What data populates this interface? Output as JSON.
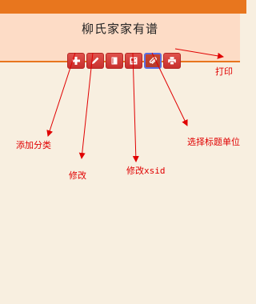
{
  "header": {
    "title": "柳氏家家有谱"
  },
  "toolbar": {
    "buttons": [
      {
        "icon": "plus-icon"
      },
      {
        "icon": "pencil-icon"
      },
      {
        "icon": "book-icon"
      },
      {
        "icon": "id-card-icon"
      },
      {
        "icon": "paperclip-icon",
        "selected": true
      },
      {
        "icon": "printer-icon"
      }
    ]
  },
  "annotations": {
    "add_category": "添加分类",
    "edit": "修改",
    "edit_xsid": "修改xsid",
    "select_title_unit": "选择标题单位",
    "print": "打印"
  },
  "colors": {
    "background": "#f8efe0",
    "top_bar": "#e8761e",
    "header_panel": "#fddcc6",
    "button_red": "#d43c37",
    "annotation_red": "#e00000"
  }
}
